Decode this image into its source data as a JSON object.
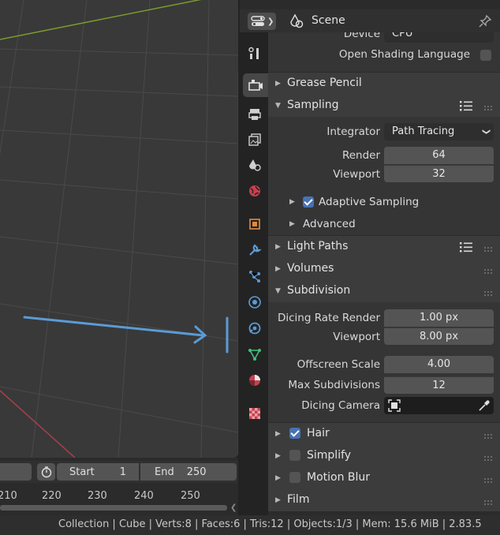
{
  "properties": {
    "context_label": "Scene",
    "top_rows": {
      "device_label": "Device",
      "device_value": "CPU",
      "osl_label": "Open Shading Language",
      "osl_checked": false
    },
    "panels": {
      "grease_pencil": "Grease Pencil",
      "sampling": {
        "title": "Sampling",
        "integrator_label": "Integrator",
        "integrator_value": "Path Tracing",
        "render_label": "Render",
        "render_value": "64",
        "viewport_label": "Viewport",
        "viewport_value": "32",
        "adaptive_label": "Adaptive Sampling",
        "adaptive_checked": true,
        "advanced_label": "Advanced"
      },
      "light_paths": "Light Paths",
      "volumes": "Volumes",
      "subdivision": {
        "title": "Subdivision",
        "dicing_render_label": "Dicing Rate Render",
        "dicing_render_value": "1.00 px",
        "viewport_label": "Viewport",
        "viewport_value": "8.00 px",
        "offscreen_label": "Offscreen Scale",
        "offscreen_value": "4.00",
        "max_subdiv_label": "Max Subdivisions",
        "max_subdiv_value": "12",
        "dicing_camera_label": "Dicing Camera"
      },
      "hair": {
        "title": "Hair",
        "checked": true
      },
      "simplify": {
        "title": "Simplify",
        "checked": false
      },
      "motion_blur": {
        "title": "Motion Blur",
        "checked": false
      },
      "film": "Film"
    },
    "tabs": [
      "tool-icon",
      "render-icon",
      "output-icon",
      "view-layer-icon",
      "scene-icon",
      "world-icon",
      "object-icon",
      "modifier-icon",
      "particles-icon",
      "physics-icon",
      "constraints-icon",
      "data-icon",
      "material-icon",
      "texture-icon"
    ]
  },
  "timeline": {
    "start_label": "Start",
    "start_value": "1",
    "end_label": "End",
    "end_value": "250",
    "ruler": [
      "210",
      "220",
      "230",
      "240",
      "250"
    ]
  },
  "status_bar": {
    "text": "Collection | Cube | Verts:8 | Faces:6 | Tris:12 | Objects:1/3 | Mem: 15.6 MiB | 2.83.5"
  },
  "colors": {
    "accent_blue": "#4772b3",
    "annotation_arrow": "#5b9bd5",
    "axis_x_red": "#a8404f",
    "axis_y_green": "#7a9a2e"
  }
}
